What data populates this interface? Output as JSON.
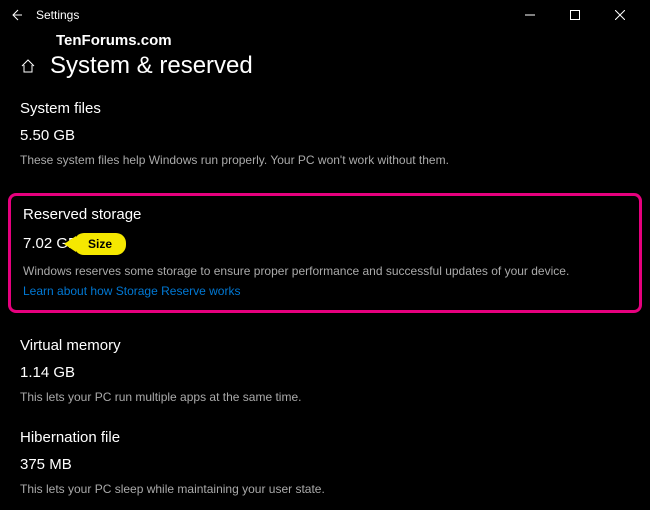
{
  "titlebar": {
    "app_name": "Settings"
  },
  "watermark": "TenForums.com",
  "header": {
    "page_title": "System & reserved"
  },
  "sections": {
    "system_files": {
      "title": "System files",
      "value": "5.50 GB",
      "desc": "These system files help Windows run properly. Your PC won't work without them."
    },
    "reserved_storage": {
      "title": "Reserved storage",
      "value": "7.02 GB",
      "annotation": "Size",
      "desc": "Windows reserves some storage to ensure proper performance and successful updates of your device.",
      "link": "Learn about how Storage Reserve works"
    },
    "virtual_memory": {
      "title": "Virtual memory",
      "value": "1.14 GB",
      "desc": "This lets your PC run multiple apps at the same time."
    },
    "hibernation_file": {
      "title": "Hibernation file",
      "value": "375 MB",
      "desc": "This lets your PC sleep while maintaining your user state."
    }
  }
}
